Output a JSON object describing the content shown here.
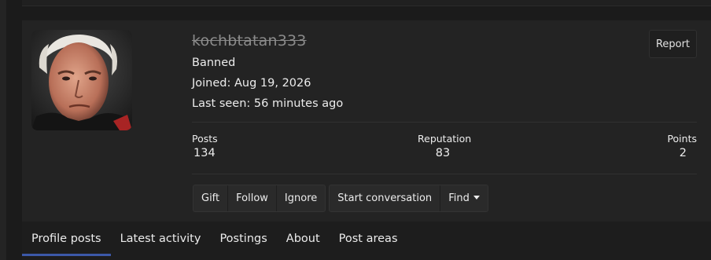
{
  "profile": {
    "username": "kochbtatan333",
    "status": "Banned",
    "joined": "Joined: Aug 19, 2026",
    "last_seen": "Last seen: 56 minutes ago",
    "avatar_icon": "user-avatar-photo",
    "report_label": "Report"
  },
  "stats": [
    {
      "label": "Posts",
      "value": "134"
    },
    {
      "label": "Reputation",
      "value": "83"
    },
    {
      "label": "Points",
      "value": "2"
    }
  ],
  "actions": {
    "group1": [
      "Gift",
      "Follow",
      "Ignore"
    ],
    "group2": [
      "Start conversation",
      "Find"
    ]
  },
  "tabs": [
    {
      "label": "Profile posts",
      "active": true
    },
    {
      "label": "Latest activity",
      "active": false
    },
    {
      "label": "Postings",
      "active": false
    },
    {
      "label": "About",
      "active": false
    },
    {
      "label": "Post areas",
      "active": false
    }
  ],
  "colors": {
    "background": "#1b1b1b",
    "card": "#232323",
    "active_tab_underline": "#3c58a8",
    "username_struck": "#8a8a8a"
  }
}
